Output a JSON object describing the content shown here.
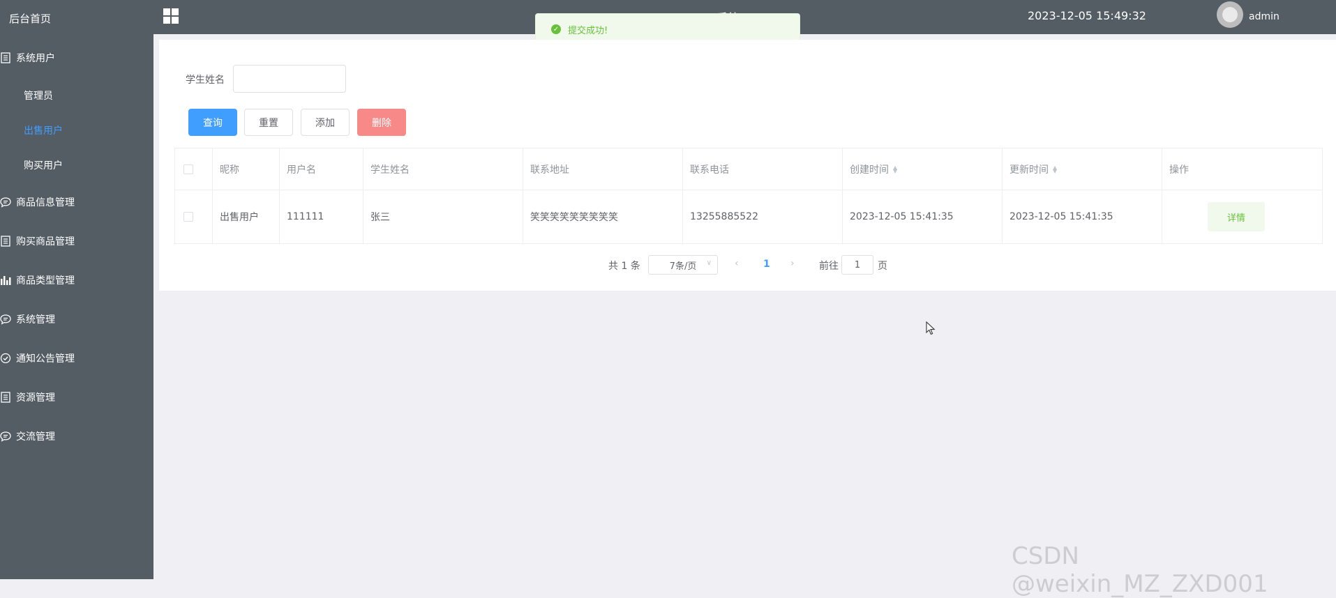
{
  "sidebar": {
    "home": "后台首页",
    "items": [
      {
        "label": "系统用户",
        "icon": "list-icon"
      },
      {
        "label": "商品信息管理",
        "icon": "chat-icon"
      },
      {
        "label": "购买商品管理",
        "icon": "list-icon"
      },
      {
        "label": "商品类型管理",
        "icon": "chart-icon"
      },
      {
        "label": "系统管理",
        "icon": "chat-icon"
      },
      {
        "label": "通知公告管理",
        "icon": "check-circle-icon"
      },
      {
        "label": "资源管理",
        "icon": "list-icon"
      },
      {
        "label": "交流管理",
        "icon": "chat-icon"
      }
    ],
    "subitems": [
      {
        "label": "管理员",
        "active": false
      },
      {
        "label": "出售用户",
        "active": true
      },
      {
        "label": "购买用户",
        "active": false
      }
    ]
  },
  "topbar": {
    "title": "… …系统",
    "datetime": "2023-12-05 15:49:32",
    "username": "admin"
  },
  "toast": {
    "message": "提交成功!",
    "color": "#67c23a"
  },
  "search": {
    "label": "学生姓名",
    "value": "",
    "placeholder": ""
  },
  "buttons": {
    "query": "查询",
    "reset": "重置",
    "add": "添加",
    "delete": "删除"
  },
  "table": {
    "headers": [
      "昵称",
      "用户名",
      "学生姓名",
      "联系地址",
      "联系电话",
      "创建时间",
      "更新时间",
      "操作"
    ],
    "rows": [
      {
        "nickname": "出售用户",
        "username": "111111",
        "student_name": "张三",
        "address": "笑笑笑笑笑笑笑笑笑",
        "phone": "13255885522",
        "created": "2023-12-05 15:41:35",
        "updated": "2023-12-05 15:41:35",
        "action": "详情"
      }
    ]
  },
  "pagination": {
    "total": "共 1 条",
    "page_size": "7条/页",
    "current_page": "1",
    "goto_label": "前往",
    "goto_value": "1",
    "goto_unit": "页"
  },
  "watermark": "CSDN @weixin_MZ_ZXD001",
  "colors": {
    "sidebar_bg": "#545c64",
    "accent": "#409eff",
    "danger": "#f78989",
    "success": "#67c23a"
  }
}
